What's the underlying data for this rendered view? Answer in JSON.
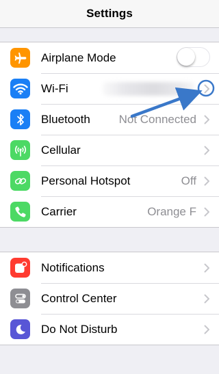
{
  "navbar": {
    "title": "Settings"
  },
  "colors": {
    "airplane": "#ff9500",
    "wifi": "#1a7ff5",
    "bluetooth": "#1a7ff5",
    "cellular": "#4cd964",
    "hotspot": "#4cd964",
    "carrier": "#4cd964",
    "notifications": "#ff3b30",
    "control_center": "#8e8e93",
    "do_not_disturb": "#5856d6",
    "annotation": "#3a78c9"
  },
  "connectivity": {
    "airplane_mode": {
      "label": "Airplane Mode",
      "icon": "airplane-icon",
      "toggle_on": false
    },
    "wifi": {
      "label": "Wi-Fi",
      "icon": "wifi-icon",
      "value": ""
    },
    "bluetooth": {
      "label": "Bluetooth",
      "icon": "bluetooth-icon",
      "value": "Not Connected"
    },
    "cellular": {
      "label": "Cellular",
      "icon": "cellular-icon"
    },
    "hotspot": {
      "label": "Personal Hotspot",
      "icon": "hotspot-icon",
      "value": "Off"
    },
    "carrier": {
      "label": "Carrier",
      "icon": "phone-icon",
      "value": "Orange F"
    }
  },
  "system": {
    "notifications": {
      "label": "Notifications",
      "icon": "notifications-icon"
    },
    "control_center": {
      "label": "Control Center",
      "icon": "control-center-icon"
    },
    "do_not_disturb": {
      "label": "Do Not Disturb",
      "icon": "moon-icon"
    }
  }
}
